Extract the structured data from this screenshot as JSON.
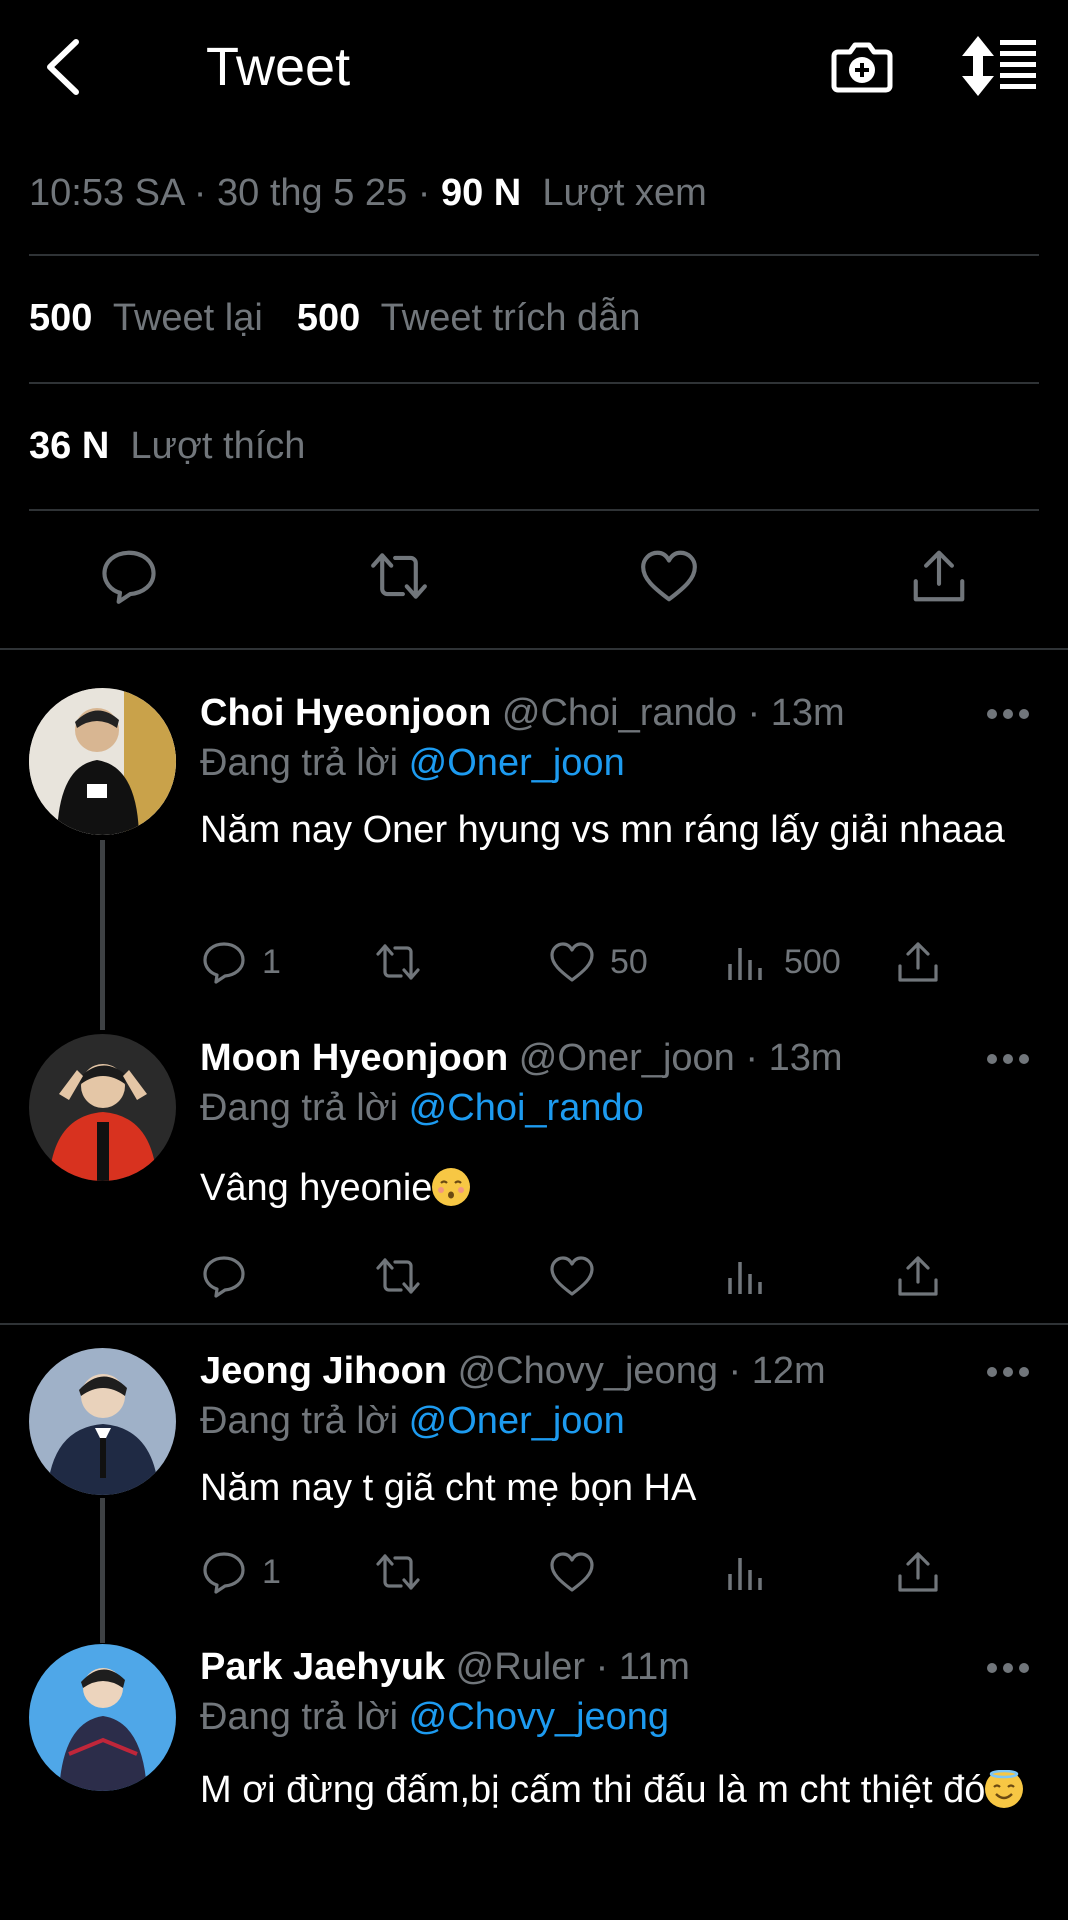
{
  "header": {
    "title": "Tweet"
  },
  "meta": {
    "time": "10:53 SA",
    "date": "30 thg 5 25",
    "views_count": "90 N",
    "views_label": "Lượt xem"
  },
  "stats": {
    "retweets_count": "500",
    "retweets_label": "Tweet lại",
    "quotes_count": "500",
    "quotes_label": "Tweet trích dẫn",
    "likes_count": "36 N",
    "likes_label": "Lượt thích"
  },
  "replies": [
    {
      "name": "Choi Hyeonjoon",
      "handle": "@Choi_rando",
      "time": "13m",
      "replying_prefix": "Đang trả lời",
      "replying_to": "@Oner_joon",
      "text": "Năm nay Oner hyung vs mn ráng lấy giải nhaaa",
      "reply_count": "1",
      "retweet_count": "",
      "like_count": "50",
      "view_count": "500"
    },
    {
      "name": "Moon Hyeonjoon",
      "handle": "@Oner_joon",
      "time": "13m",
      "replying_prefix": "Đang trả lời",
      "replying_to": "@Choi_rando",
      "text": "Vâng hyeonie",
      "reply_count": "",
      "retweet_count": "",
      "like_count": "",
      "view_count": ""
    },
    {
      "name": "Jeong Jihoon",
      "handle": "@Chovy_jeong",
      "time": "12m",
      "replying_prefix": "Đang trả lời",
      "replying_to": "@Oner_joon",
      "text": "Năm nay t giã cht mẹ bọn HA",
      "reply_count": "1",
      "retweet_count": "",
      "like_count": "",
      "view_count": ""
    },
    {
      "name": "Park Jaehyuk",
      "handle": "@Ruler",
      "time": "11m",
      "replying_prefix": "Đang trả lời",
      "replying_to": "@Chovy_jeong",
      "text": "M ơi đừng đấm,bị cấm thi đấu là m cht thiệt đó"
    }
  ],
  "colors": {
    "background": "#000000",
    "text": "#e7e9ea",
    "muted": "#71767b",
    "link": "#1d9bf0",
    "divider": "#2f3336"
  },
  "icons": [
    "back-arrow-icon",
    "camera-plus-icon",
    "sort-icon",
    "reply-icon",
    "retweet-icon",
    "like-icon",
    "views-icon",
    "share-icon",
    "more-icon"
  ]
}
